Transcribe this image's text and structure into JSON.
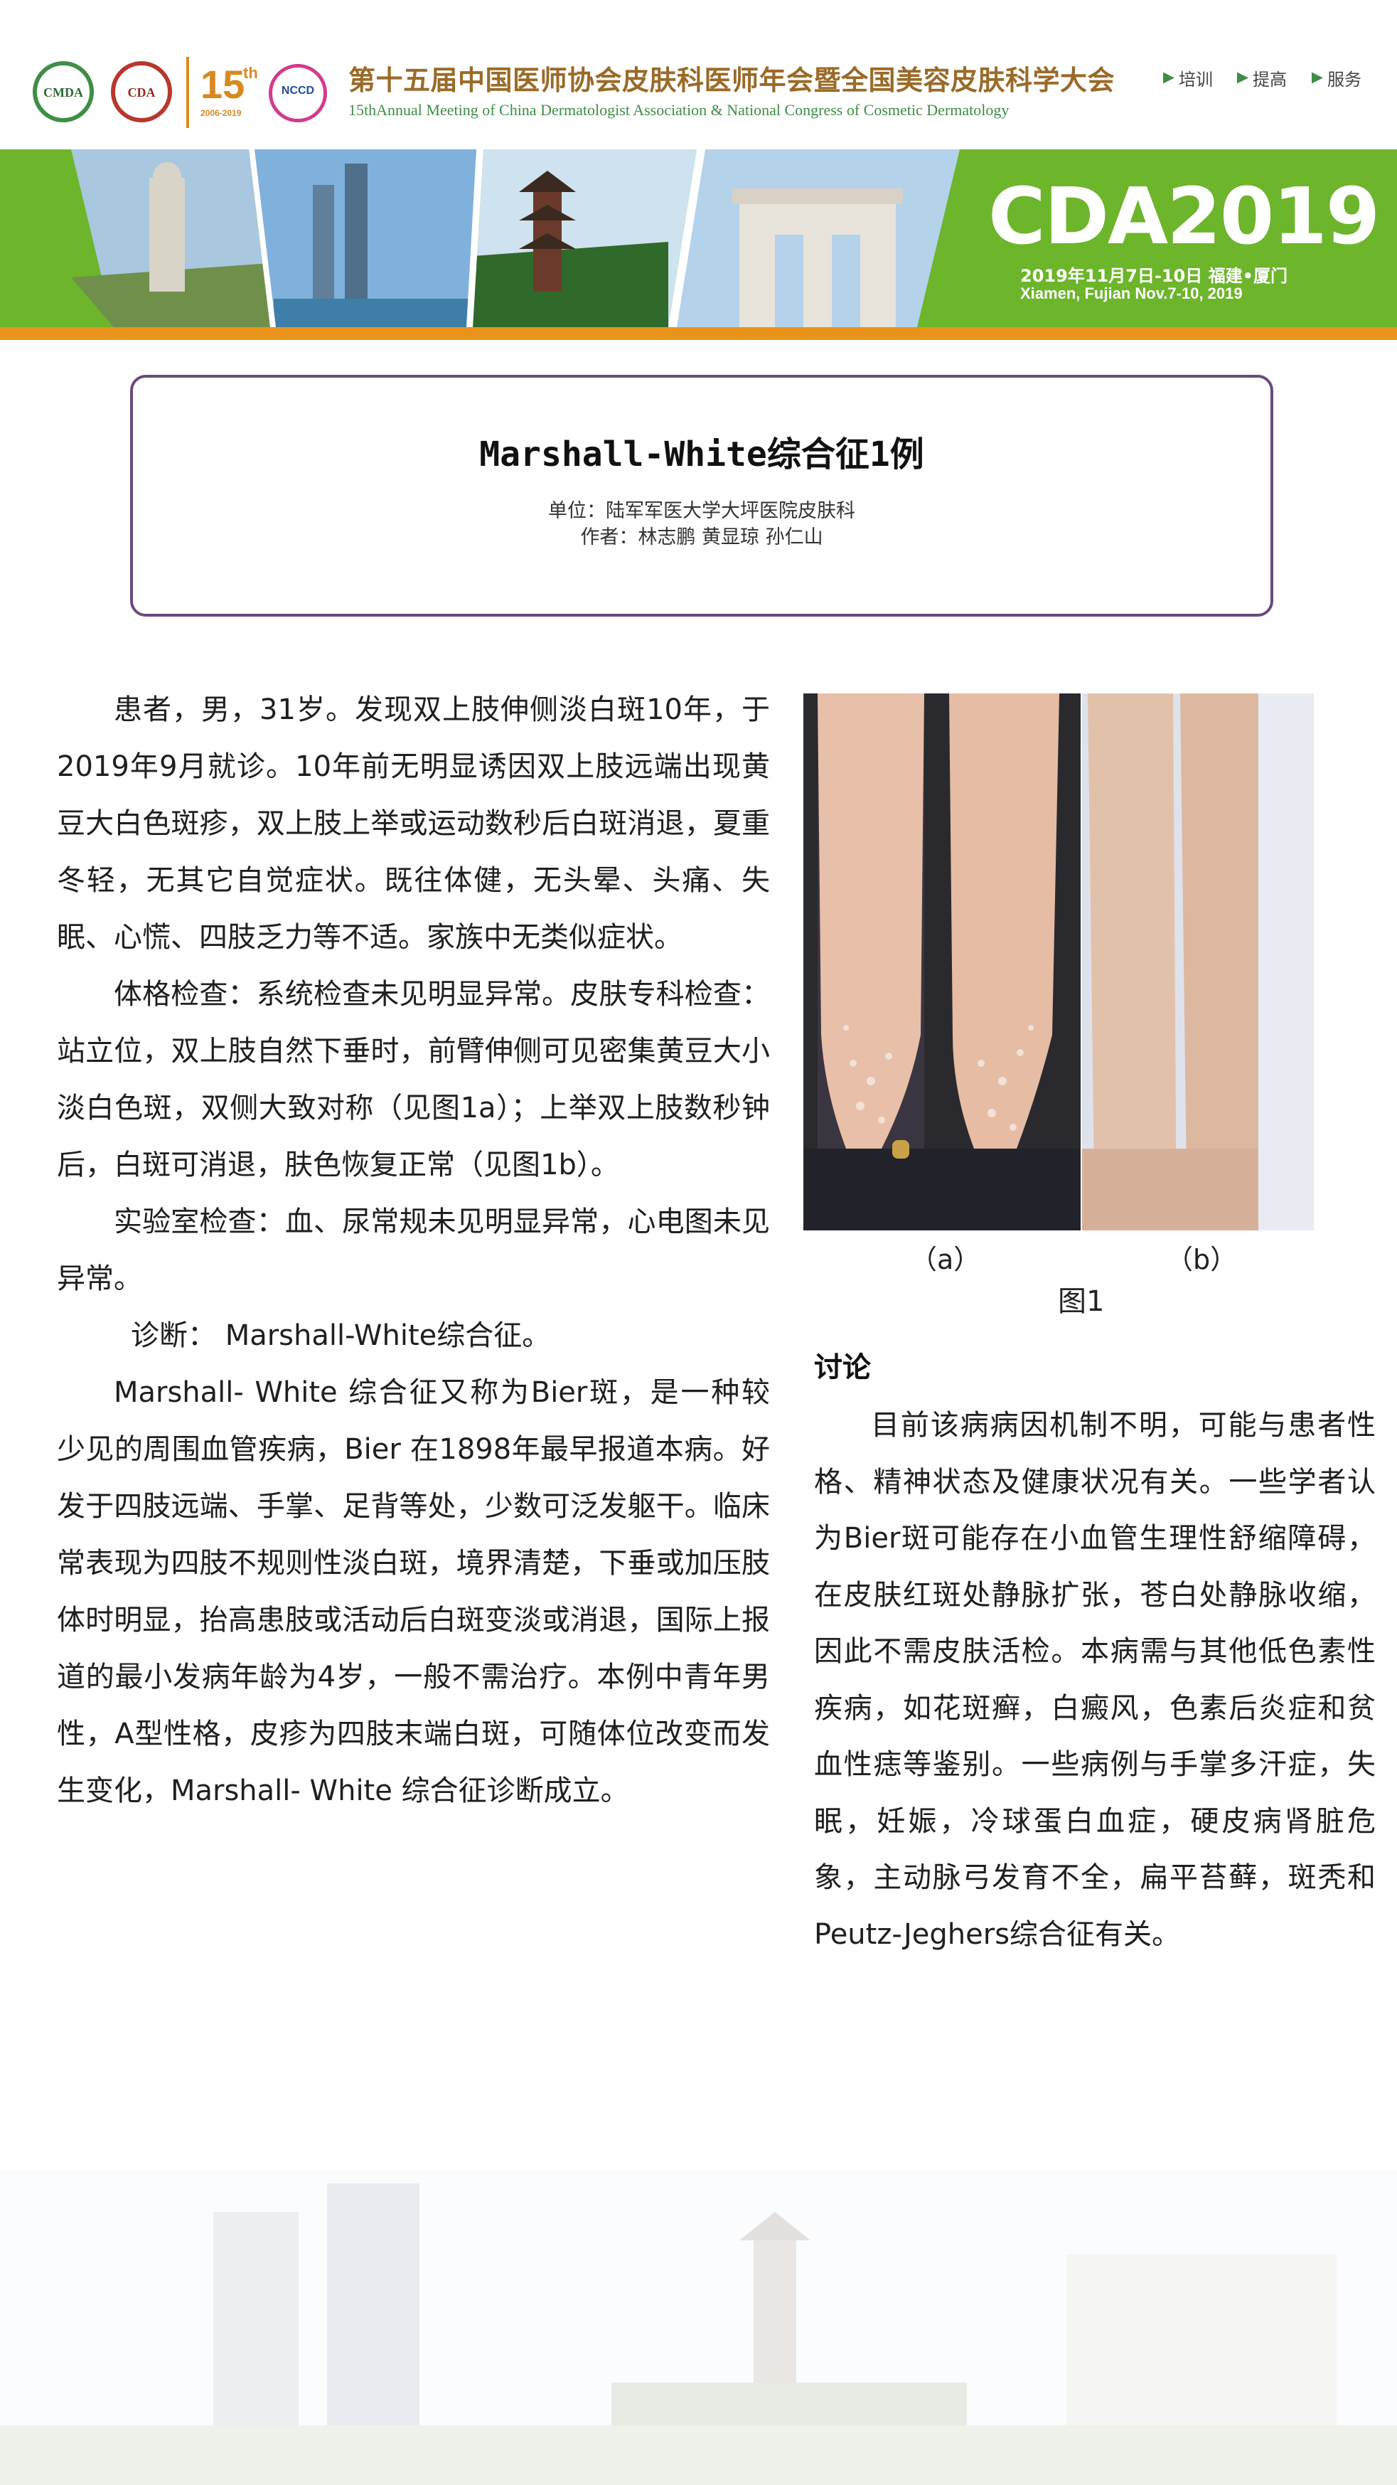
{
  "header": {
    "logos": [
      "CMDA",
      "CDA",
      "15",
      "th",
      "2006-2019",
      "NCCD"
    ],
    "title": "第十五届中国医师协会皮肤科医师年会暨全国美容皮肤科学大会",
    "subtitle": "15thAnnual Meeting of China Dermatologist Association & National Congress of Cosmetic Dermatology",
    "nav": [
      "培训",
      "提高",
      "服务"
    ]
  },
  "banner": {
    "brand": "CDA2019",
    "date_line": "2019年11月7日-10日    福建•厦门",
    "place_line": "Xiamen, Fujian  Nov.7-10, 2019",
    "colors": {
      "green": "#6db52b",
      "orange": "#e9931b"
    }
  },
  "paper": {
    "title": "Marshall-White综合征1例",
    "affiliation": "单位：陆军军医大学大坪医院皮肤科",
    "authors": "作者：林志鹏 黄显琼 孙仁山"
  },
  "body_left": [
    "患者，男，31岁。发现双上肢伸侧淡白斑10年，于2019年9月就诊。10年前无明显诱因双上肢远端出现黄豆大白色斑疹，双上肢上举或运动数秒后白斑消退，夏重冬轻，无其它自觉症状。既往体健，无头晕、头痛、失眠、心慌、四肢乏力等不适。家族中无类似症状。",
    "体格检查：系统检查未见明显异常。皮肤专科检查：站立位，双上肢自然下垂时，前臂伸侧可见密集黄豆大小淡白色斑，双侧大致对称（见图1a）；上举双上肢数秒钟后，白斑可消退，肤色恢复正常（见图1b）。",
    "实验室检查：血、尿常规未见明显异常，心电图未见异常。",
    "诊断： Marshall-White综合征。",
    "Marshall- White 综合征又称为Bier斑，是一种较少见的周围血管疾病，Bier 在1898年最早报道本病。好发于四肢远端、手掌、足背等处，少数可泛发躯干。临床常表现为四肢不规则性淡白斑，境界清楚，下垂或加压肢体时明显，抬高患肢或活动后白斑变淡或消退，国际上报道的最小发病年龄为4岁，一般不需治疗。本例中青年男性，A型性格，皮疹为四肢末端白斑，可随体位改变而发生变化，Marshall- White 综合征诊断成立。"
  ],
  "figure": {
    "caption_a": "（a）",
    "caption_b": "（b）",
    "title": "图1"
  },
  "discussion": {
    "heading": "讨论",
    "text": "目前该病病因机制不明，可能与患者性格、精神状态及健康状况有关。一些学者认为Bier斑可能存在小血管生理性舒缩障碍，在皮肤红斑处静脉扩张，苍白处静脉收缩，因此不需皮肤活检。本病需与其他低色素性疾病，如花斑癣，白癜风，色素后炎症和贫血性痣等鉴别。一些病例与手掌多汗症，失眠，妊娠，冷球蛋白血症，硬皮病肾脏危象，主动脉弓发育不全，扁平苔藓，斑秃和Peutz-Jeghers综合征有关。"
  }
}
